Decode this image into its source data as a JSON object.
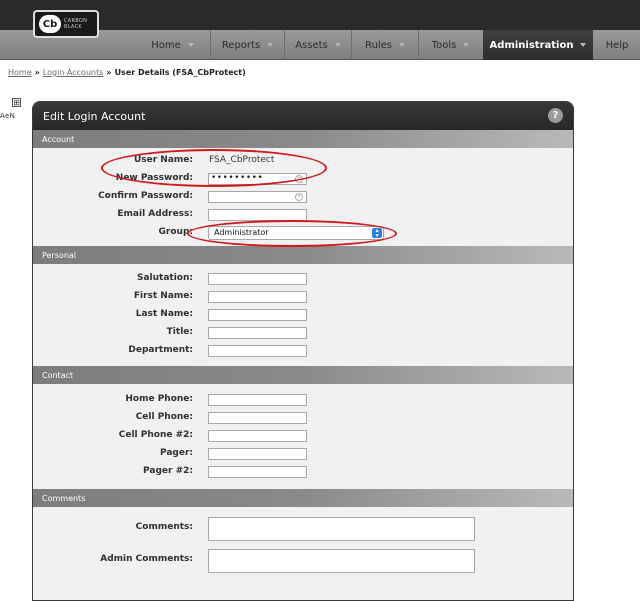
{
  "logo": {
    "mark": "Cb",
    "line1": "CARBON",
    "line2": "BLACK"
  },
  "nav": {
    "items": [
      {
        "label": "Home"
      },
      {
        "label": "Reports"
      },
      {
        "label": "Assets"
      },
      {
        "label": "Rules"
      },
      {
        "label": "Tools"
      },
      {
        "label": "Administration",
        "active": true
      },
      {
        "label": "Help"
      }
    ]
  },
  "breadcrumb": {
    "home": "Home",
    "login_accounts": "Login Accounts",
    "current": "User Details (FSA_CbProtect)",
    "separator": "»"
  },
  "gutter": {
    "toggle": "⊞",
    "label": "AeN"
  },
  "panel": {
    "title": "Edit Login Account",
    "help": "?"
  },
  "sections": {
    "account": {
      "title": "Account",
      "user_name_label": "User Name:",
      "user_name_value": "FSA_CbProtect",
      "new_password_label": "New Password:",
      "new_password_value": "•••••••••",
      "confirm_password_label": "Confirm Password:",
      "email_label": "Email Address:",
      "group_label": "Group:",
      "group_value": "Administrator"
    },
    "personal": {
      "title": "Personal",
      "salutation_label": "Salutation:",
      "first_name_label": "First Name:",
      "last_name_label": "Last Name:",
      "title_label": "Title:",
      "department_label": "Department:"
    },
    "contact": {
      "title": "Contact",
      "home_phone_label": "Home Phone:",
      "cell_phone_label": "Cell Phone:",
      "cell_phone2_label": "Cell Phone #2:",
      "pager_label": "Pager:",
      "pager2_label": "Pager #2:"
    },
    "comments": {
      "title": "Comments",
      "comments_label": "Comments:",
      "admin_comments_label": "Admin Comments:"
    }
  },
  "colors": {
    "annotation": "#d0191e",
    "select_accent": "#2e7fe0",
    "header_dark": "#2a2a2a",
    "active_tab": "#333333"
  }
}
